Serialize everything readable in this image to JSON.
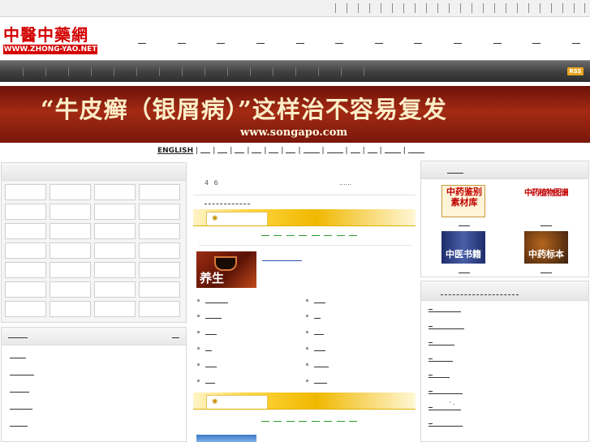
{
  "header": {
    "logo": {
      "cn": "中醫中藥網",
      "en": "WWW.ZHONG-YAO.NET",
      "brand_color": "#d40000"
    },
    "rss_label": "RSS"
  },
  "banner": {
    "headline": "“牛皮癣（银屑病）”这样治不容易复发",
    "url": "www.songapo.com"
  },
  "lang_bar": {
    "english": "ENGLISH",
    "separator": "|"
  },
  "middle": {
    "stat_text": "4 6",
    "ellipsis": "......",
    "feature_image_text": "养生"
  },
  "right": {
    "books": [
      {
        "text": "中药鉴别素材库",
        "icon": "book-cover-icon"
      },
      {
        "text": "中药植物图谱",
        "icon": "calligraphy-icon"
      },
      {
        "text": "中医书籍",
        "icon": "book-cover-icon"
      },
      {
        "text": "中药标本",
        "icon": "herb-photo-icon"
      }
    ],
    "bullet_marks": "·  ."
  },
  "colors": {
    "accent_yellow": "#f0b800",
    "link_green": "#2b9a2b",
    "banner_red": "#a32a13",
    "menubar_dark": "#3f3f3f"
  }
}
